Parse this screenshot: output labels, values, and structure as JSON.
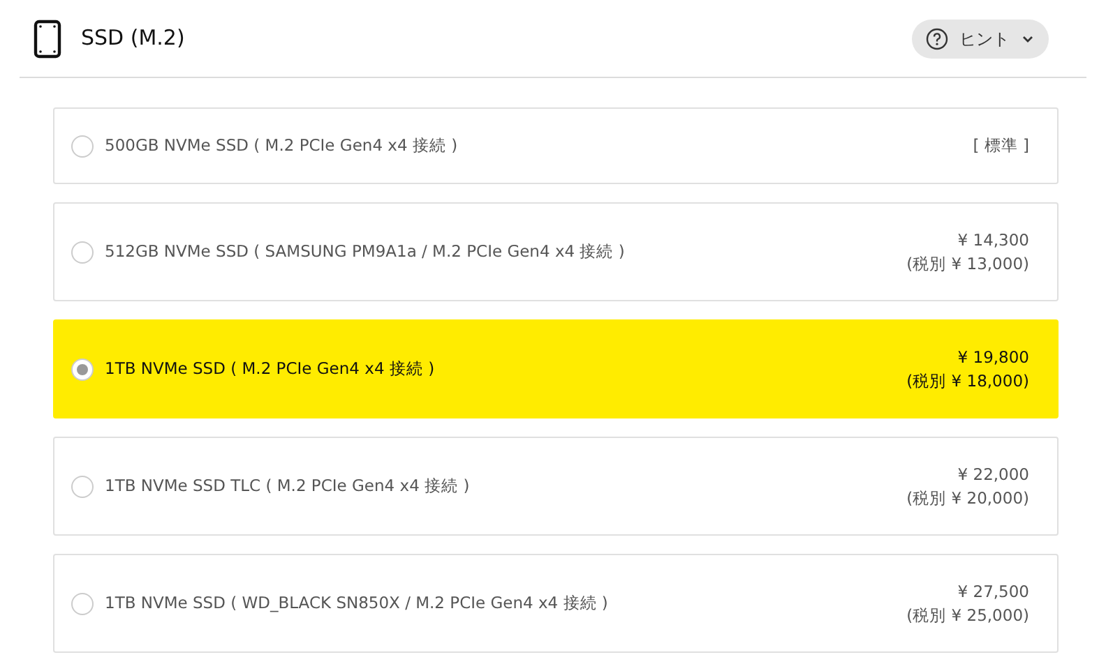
{
  "section": {
    "title": "SSD (M.2)"
  },
  "hint_button": {
    "label": "ヒント",
    "expanded": false
  },
  "options": [
    {
      "label": "500GB NVMe SSD ( M.2 PCIe Gen4 x4 接続 )",
      "selected": false,
      "price": "[ 標準 ]"
    },
    {
      "label": "512GB NVMe SSD ( SAMSUNG PM9A1a / M.2 PCIe Gen4 x4 接続 )",
      "selected": false,
      "price": "¥ 14,300",
      "price_ex_tax": "(税別 ¥ 13,000)"
    },
    {
      "label": "1TB NVMe SSD ( M.2 PCIe Gen4 x4 接続 )",
      "selected": true,
      "price": "¥ 19,800",
      "price_ex_tax": "(税別 ¥ 18,000)"
    },
    {
      "label": "1TB NVMe SSD TLC ( M.2 PCIe Gen4 x4 接続 )",
      "selected": false,
      "price": "¥ 22,000",
      "price_ex_tax": "(税別 ¥ 20,000)"
    },
    {
      "label": "1TB NVMe SSD ( WD_BLACK SN850X / M.2 PCIe Gen4 x4 接続 )",
      "selected": false,
      "price": "¥ 27,500",
      "price_ex_tax": "(税別 ¥ 25,000)"
    }
  ]
}
